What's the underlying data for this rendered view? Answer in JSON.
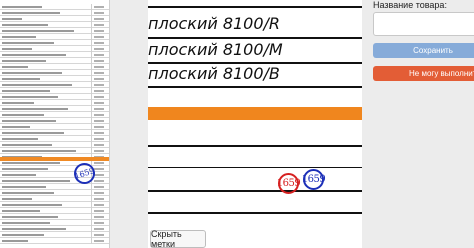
{
  "document": {
    "line1": "плоский  8100/R",
    "line2": "плоский  8100/М",
    "line3": "плоский  8100/В",
    "stamp_red": "1659",
    "stamp_blue": "1659"
  },
  "thumbnail": {
    "stamp_blue": "1659"
  },
  "controls": {
    "hide_labels_button": "Скрыть метки"
  },
  "panel": {
    "field_label": "Название товара:",
    "product_input_value": "",
    "save_button": "Сохранить",
    "cant_button": "Не могу выполнить р"
  },
  "colors": {
    "highlight_orange": "#f0861e",
    "save_blue": "#86abd9",
    "cant_red": "#e35d36",
    "stamp_red": "#d62020",
    "stamp_blue": "#1c2fb8"
  }
}
